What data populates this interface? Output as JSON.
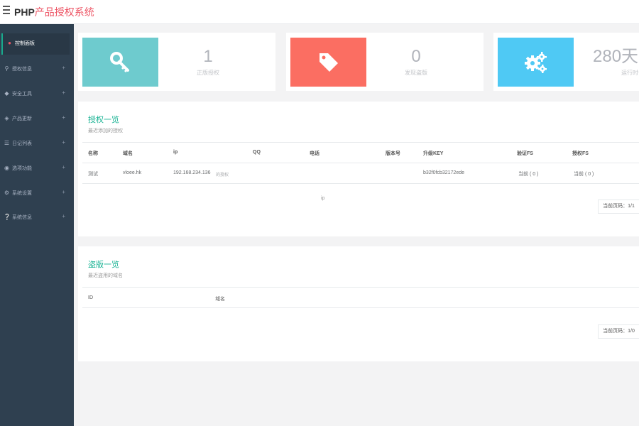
{
  "header": {
    "brand_prefix": "PHP",
    "brand_suffix": "产品授权系统"
  },
  "sidebar": {
    "items": [
      {
        "label": "控制面板",
        "icon": "dashboard-icon",
        "active": true
      },
      {
        "label": "授权信息",
        "icon": "key-icon",
        "plus": "+"
      },
      {
        "label": "安全工具",
        "icon": "shield-icon",
        "plus": "+"
      },
      {
        "label": "产品更新",
        "icon": "tag-icon",
        "plus": "+"
      },
      {
        "label": "日记列表",
        "icon": "list-icon",
        "plus": "+"
      },
      {
        "label": "选项功能",
        "icon": "options-icon",
        "plus": "+"
      },
      {
        "label": "系统设置",
        "icon": "gears-icon",
        "plus": "+"
      },
      {
        "label": "系统信息",
        "icon": "info-icon",
        "plus": "+"
      }
    ]
  },
  "stats": [
    {
      "value": "1",
      "label": "正版授权",
      "color": "#6ecbce",
      "icon": "key-icon"
    },
    {
      "value": "0",
      "label": "发现盗版",
      "color": "#fb6e62",
      "icon": "tag-icon"
    },
    {
      "value": "280天",
      "label": "运行时长",
      "color": "#4fc9f4",
      "icon": "gears-icon"
    }
  ],
  "auth_panel": {
    "title": "授权一览",
    "subtitle": "最近添加的授权",
    "columns": [
      "名称",
      "域名",
      "ip",
      "QQ",
      "电话",
      "版本号",
      "升级KEY",
      "验证FS",
      "授权FS"
    ],
    "rows": [
      {
        "name": "测试",
        "domain": "vloee.hk",
        "ip": "192.168.234.136",
        "ip_extra": "的授权",
        "qq": "",
        "phone": "",
        "version": "",
        "key": "b32f0fcb32172ede",
        "verify": "当前 ( 0 )",
        "auth": "当前 ( 0 )"
      }
    ],
    "ghost_text": "ip",
    "pager": "当前页码：1/1"
  },
  "piracy_panel": {
    "title": "盗版一览",
    "subtitle": "最近盗用的域名",
    "columns": [
      "ID",
      "域名"
    ],
    "pager": "当前页码：1/0"
  }
}
